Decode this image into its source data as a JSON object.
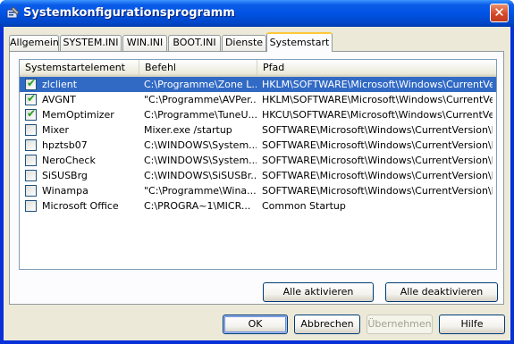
{
  "window": {
    "title": "Systemkonfigurationsprogramm",
    "close_glyph": "✕",
    "icon": "msconfig-icon"
  },
  "tabs": [
    {
      "label": "Allgemein",
      "active": false
    },
    {
      "label": "SYSTEM.INI",
      "active": false
    },
    {
      "label": "WIN.INI",
      "active": false
    },
    {
      "label": "BOOT.INI",
      "active": false
    },
    {
      "label": "Dienste",
      "active": false
    },
    {
      "label": "Systemstart",
      "active": true
    }
  ],
  "list": {
    "columns": [
      "Systemstartelement",
      "Befehl",
      "Pfad"
    ],
    "rows": [
      {
        "checked": true,
        "selected": true,
        "item": "zlclient",
        "command": "C:\\Programme\\Zone L...",
        "path": "HKLM\\SOFTWARE\\Microsoft\\Windows\\CurrentVer..."
      },
      {
        "checked": true,
        "selected": false,
        "item": "AVGNT",
        "command": "\"C:\\Programme\\AVPer...",
        "path": "HKLM\\SOFTWARE\\Microsoft\\Windows\\CurrentVer..."
      },
      {
        "checked": true,
        "selected": false,
        "item": "MemOptimizer",
        "command": "C:\\Programme\\TuneU...",
        "path": "HKCU\\SOFTWARE\\Microsoft\\Windows\\CurrentVer..."
      },
      {
        "checked": false,
        "selected": false,
        "item": "Mixer",
        "command": "Mixer.exe /startup",
        "path": "SOFTWARE\\Microsoft\\Windows\\CurrentVersion\\Run"
      },
      {
        "checked": false,
        "selected": false,
        "item": "hpztsb07",
        "command": "C:\\WINDOWS\\System...",
        "path": "SOFTWARE\\Microsoft\\Windows\\CurrentVersion\\Run"
      },
      {
        "checked": false,
        "selected": false,
        "item": "NeroCheck",
        "command": "C:\\WINDOWS\\System...",
        "path": "SOFTWARE\\Microsoft\\Windows\\CurrentVersion\\Run"
      },
      {
        "checked": false,
        "selected": false,
        "item": "SiSUSBrg",
        "command": "C:\\WINDOWS\\SiSUSBr...",
        "path": "SOFTWARE\\Microsoft\\Windows\\CurrentVersion\\Run"
      },
      {
        "checked": false,
        "selected": false,
        "item": "Winampa",
        "command": "\"C:\\Programme\\Wina...",
        "path": "SOFTWARE\\Microsoft\\Windows\\CurrentVersion\\Run"
      },
      {
        "checked": false,
        "selected": false,
        "item": "Microsoft Office",
        "command": "C:\\PROGRA~1\\MICR...",
        "path": "Common Startup"
      }
    ]
  },
  "panel_buttons": {
    "enable_all": "Alle aktivieren",
    "disable_all": "Alle deaktivieren"
  },
  "dialog_buttons": {
    "ok": "OK",
    "cancel": "Abbrechen",
    "apply": "Übernehmen",
    "help": "Hilfe"
  },
  "colors": {
    "title_bar": "#0053e4",
    "selection": "#316ac5",
    "check": "#21a121",
    "tab_highlight": "#ffc83c"
  }
}
